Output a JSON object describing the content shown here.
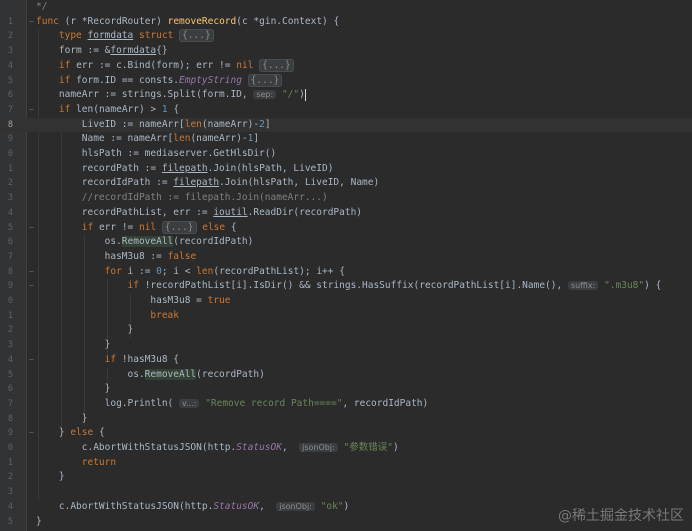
{
  "editor": {
    "current_line": 8,
    "line_numbers": [
      "",
      "1",
      "2",
      "3",
      "4",
      "5",
      "6",
      "7",
      "8",
      "9",
      "0",
      "1",
      "2",
      "3",
      "4",
      "5",
      "6",
      "7",
      "8",
      "9",
      "0",
      "1",
      "2",
      "3",
      "4",
      "5",
      "6",
      "7",
      "8",
      "9",
      "0",
      "1",
      "2",
      "3",
      "4",
      "5"
    ],
    "lines": [
      [
        {
          "t": "*/",
          "c": "cm"
        }
      ],
      [
        {
          "t": "func",
          "c": "kw"
        },
        {
          "t": " (r "
        },
        {
          "t": "*RecordRouter"
        },
        {
          "t": ") "
        },
        {
          "t": "removeRecord",
          "c": "fn"
        },
        {
          "t": "(c "
        },
        {
          "t": "*gin.Context"
        },
        {
          "t": ") {"
        }
      ],
      [
        {
          "t": "    "
        },
        {
          "t": "type",
          "c": "kw"
        },
        {
          "t": " "
        },
        {
          "t": "formdata",
          "c": "ul"
        },
        {
          "t": " "
        },
        {
          "t": "struct",
          "c": "kw"
        },
        {
          "t": " "
        },
        {
          "t": "{...}",
          "c": "fold-tag"
        }
      ],
      [
        {
          "t": "    form := &"
        },
        {
          "t": "formdata",
          "c": "ul"
        },
        {
          "t": "{}"
        }
      ],
      [
        {
          "t": "    "
        },
        {
          "t": "if",
          "c": "kw"
        },
        {
          "t": " err := c.Bind(form); err != "
        },
        {
          "t": "nil",
          "c": "kw"
        },
        {
          "t": " "
        },
        {
          "t": "{...}",
          "c": "fold-tag"
        }
      ],
      [
        {
          "t": "    "
        },
        {
          "t": "if",
          "c": "kw"
        },
        {
          "t": " form.ID == consts."
        },
        {
          "t": "EmptyString",
          "c": "const"
        },
        {
          "t": " "
        },
        {
          "t": "{...}",
          "c": "fold-tag"
        }
      ],
      [
        {
          "t": "    nameArr := strings.Split(form.ID, "
        },
        {
          "t": "sep:",
          "c": "hint"
        },
        {
          "t": " "
        },
        {
          "t": "\"/\"",
          "c": "str"
        },
        {
          "t": ")"
        },
        {
          "t": "",
          "c": "caret"
        }
      ],
      [
        {
          "t": "    "
        },
        {
          "t": "if",
          "c": "kw"
        },
        {
          "t": " len(nameArr) > "
        },
        {
          "t": "1",
          "c": "num"
        },
        {
          "t": " {"
        }
      ],
      [
        {
          "t": "        LiveID := nameArr["
        },
        {
          "t": "len",
          "c": "kw"
        },
        {
          "t": "(nameArr)-"
        },
        {
          "t": "2",
          "c": "num"
        },
        {
          "t": "]"
        }
      ],
      [
        {
          "t": "        Name := nameArr["
        },
        {
          "t": "len",
          "c": "kw"
        },
        {
          "t": "(nameArr)-"
        },
        {
          "t": "1",
          "c": "num"
        },
        {
          "t": "]"
        }
      ],
      [
        {
          "t": "        hlsPath := mediaserver.GetHlsDir()"
        }
      ],
      [
        {
          "t": "        recordPath := "
        },
        {
          "t": "filepath",
          "c": "ul"
        },
        {
          "t": ".Join(hlsPath, LiveID)"
        }
      ],
      [
        {
          "t": "        recordIdPath := "
        },
        {
          "t": "filepath",
          "c": "ul"
        },
        {
          "t": ".Join(hlsPath, LiveID, Name)"
        }
      ],
      [
        {
          "t": "        //recordIdPath := filepath.Join(nameArr...)",
          "c": "cm"
        }
      ],
      [
        {
          "t": "        recordPathList, err := "
        },
        {
          "t": "ioutil",
          "c": "ul"
        },
        {
          "t": ".ReadDir(recordPath)"
        }
      ],
      [
        {
          "t": "        "
        },
        {
          "t": "if",
          "c": "kw"
        },
        {
          "t": " err != "
        },
        {
          "t": "nil",
          "c": "kw"
        },
        {
          "t": " "
        },
        {
          "t": "{...}",
          "c": "fold-tag"
        },
        {
          "t": " "
        },
        {
          "t": "else",
          "c": "kw"
        },
        {
          "t": " {"
        }
      ],
      [
        {
          "t": "            os."
        },
        {
          "t": "RemoveAll",
          "c": "hl"
        },
        {
          "t": "(recordIdPath)"
        }
      ],
      [
        {
          "t": "            hasM3u8 := "
        },
        {
          "t": "false",
          "c": "kw"
        }
      ],
      [
        {
          "t": "            "
        },
        {
          "t": "for",
          "c": "kw"
        },
        {
          "t": " i := "
        },
        {
          "t": "0",
          "c": "num"
        },
        {
          "t": "; i < "
        },
        {
          "t": "len",
          "c": "kw"
        },
        {
          "t": "(recordPathList); i++ {"
        }
      ],
      [
        {
          "t": "                "
        },
        {
          "t": "if",
          "c": "kw"
        },
        {
          "t": " !recordPathList[i].IsDir() && strings.HasSuffix(recordPathList[i].Name(), "
        },
        {
          "t": "suffix:",
          "c": "hint"
        },
        {
          "t": " "
        },
        {
          "t": "\".m3u8\"",
          "c": "str"
        },
        {
          "t": ") {"
        }
      ],
      [
        {
          "t": "                    hasM3u8 = "
        },
        {
          "t": "true",
          "c": "kw"
        }
      ],
      [
        {
          "t": "                    "
        },
        {
          "t": "break",
          "c": "kw"
        }
      ],
      [
        {
          "t": "                }"
        }
      ],
      [
        {
          "t": "            }"
        }
      ],
      [
        {
          "t": "            "
        },
        {
          "t": "if",
          "c": "kw"
        },
        {
          "t": " !hasM3u8 {"
        }
      ],
      [
        {
          "t": "                os."
        },
        {
          "t": "RemoveAll",
          "c": "hl"
        },
        {
          "t": "(recordPath)"
        }
      ],
      [
        {
          "t": "            }"
        }
      ],
      [
        {
          "t": "            log.Println( "
        },
        {
          "t": "v...:",
          "c": "hint"
        },
        {
          "t": " "
        },
        {
          "t": "\"Remove record Path====\"",
          "c": "str"
        },
        {
          "t": ", recordIdPath)"
        }
      ],
      [
        {
          "t": "        }"
        }
      ],
      [
        {
          "t": "    } "
        },
        {
          "t": "else",
          "c": "kw"
        },
        {
          "t": " {"
        }
      ],
      [
        {
          "t": "        c.AbortWithStatusJSON(http."
        },
        {
          "t": "StatusOK",
          "c": "const"
        },
        {
          "t": ",  "
        },
        {
          "t": "jsonObj:",
          "c": "hint"
        },
        {
          "t": " "
        },
        {
          "t": "\"参数错误\"",
          "c": "str"
        },
        {
          "t": ")"
        }
      ],
      [
        {
          "t": "        "
        },
        {
          "t": "return",
          "c": "kw"
        }
      ],
      [
        {
          "t": "    }"
        }
      ],
      [
        {
          "t": ""
        }
      ],
      [
        {
          "t": "    c.AbortWithStatusJSON(http."
        },
        {
          "t": "StatusOK",
          "c": "const"
        },
        {
          "t": ",  "
        },
        {
          "t": "jsonObj:",
          "c": "hint"
        },
        {
          "t": " "
        },
        {
          "t": "\"ok\"",
          "c": "str"
        },
        {
          "t": ")"
        }
      ],
      [
        {
          "t": "}"
        }
      ]
    ],
    "fold_markers": {
      "1": "−",
      "7": "−",
      "15": "−",
      "18": "−",
      "19": "−",
      "24": "−",
      "29": "−"
    }
  },
  "watermark": "@稀土掘金技术社区"
}
